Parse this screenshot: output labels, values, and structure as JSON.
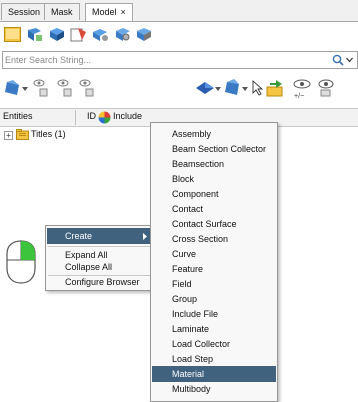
{
  "tabs": [
    {
      "label": "Session"
    },
    {
      "label": "Mask"
    },
    {
      "label": "Model",
      "close": "×"
    }
  ],
  "search": {
    "placeholder": "Enter Search String..."
  },
  "columns": {
    "entities": "Entities",
    "id": "ID",
    "include": "Include"
  },
  "tree": {
    "item_label": "Titles (1)",
    "expander": "+"
  },
  "context_menu": {
    "create": "Create",
    "expand_all": "Expand All",
    "collapse_all": "Collapse All",
    "configure_browser": "Configure Browser"
  },
  "submenu": {
    "items": [
      "Assembly",
      "Beam Section Collector",
      "Beamsection",
      "Block",
      "Component",
      "Contact",
      "Contact Surface",
      "Cross Section",
      "Curve",
      "Feature",
      "Field",
      "Group",
      "Include File",
      "Laminate",
      "Load Collector",
      "Load Step",
      "Material",
      "Multibody"
    ],
    "highlighted": "Material"
  },
  "colors": {
    "highlight": "#40627e",
    "menu_bg": "#f8f8f8"
  }
}
